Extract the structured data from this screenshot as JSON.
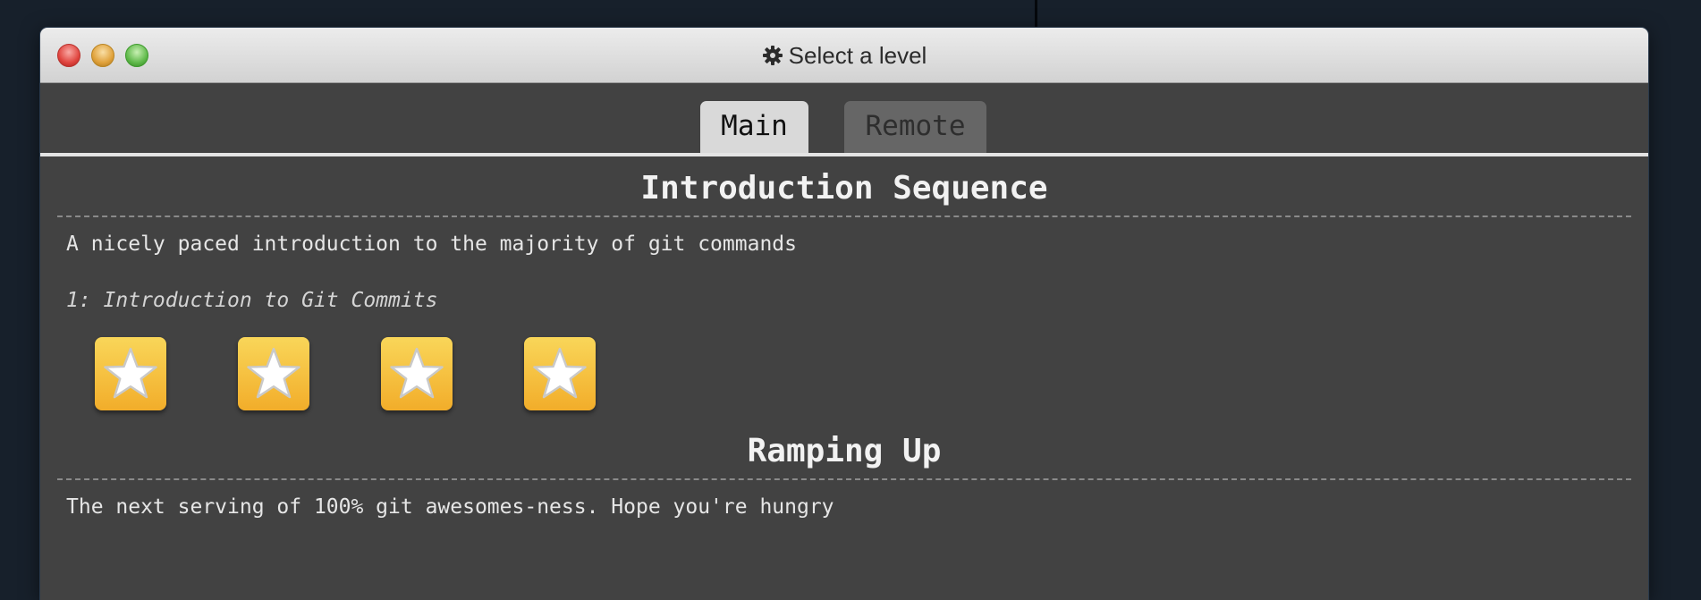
{
  "window": {
    "title": "Select a level",
    "title_icon": "gear-icon",
    "traffic_lights": [
      "close",
      "minimize",
      "maximize"
    ]
  },
  "tabs": [
    {
      "label": "Main",
      "active": true
    },
    {
      "label": "Remote",
      "active": false
    }
  ],
  "sequences": [
    {
      "title": "Introduction Sequence",
      "description": "A nicely paced introduction to the majority of git commands",
      "level_name": "1: Introduction to Git Commits",
      "levels": [
        {
          "icon": "star-icon"
        },
        {
          "icon": "star-icon"
        },
        {
          "icon": "star-icon"
        },
        {
          "icon": "star-icon"
        }
      ]
    },
    {
      "title": "Ramping Up",
      "description": "The next serving of 100% git awesomes-ness. Hope you're hungry"
    }
  ],
  "colors": {
    "desktop": "#17202b",
    "window_body": "#424242",
    "active_tab": "#d9d9d9",
    "inactive_tab": "#666666",
    "level_button": "#f5c23f"
  }
}
